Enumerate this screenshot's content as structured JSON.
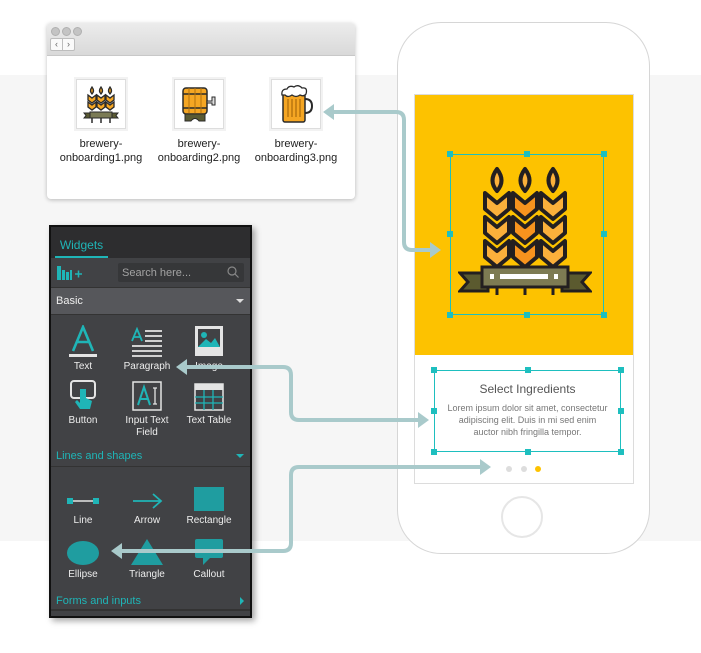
{
  "finder": {
    "nav_back": "‹",
    "nav_forward": "›",
    "files": [
      {
        "name_line1": "brewery-",
        "name_line2": "onboarding1.png",
        "icon": "wheat-icon"
      },
      {
        "name_line1": "brewery-",
        "name_line2": "onboarding2.png",
        "icon": "barrel-icon"
      },
      {
        "name_line1": "brewery-",
        "name_line2": "onboarding3.png",
        "icon": "beer-mug-icon"
      }
    ]
  },
  "widgets_panel": {
    "tab_label": "Widgets",
    "search_placeholder": "Search here...",
    "basic_section": "Basic",
    "basic_widgets": [
      {
        "label": "Text",
        "icon": "text-icon"
      },
      {
        "label": "Paragraph",
        "icon": "paragraph-icon"
      },
      {
        "label": "Image",
        "icon": "image-icon"
      },
      {
        "label": "Button",
        "icon": "button-icon"
      },
      {
        "label_line1": "Input Text",
        "label_line2": "Field",
        "icon": "input-text-icon"
      },
      {
        "label": "Text Table",
        "icon": "table-icon"
      }
    ],
    "lines_section": "Lines and shapes",
    "shape_widgets": [
      {
        "label": "Line",
        "icon": "line-icon"
      },
      {
        "label": "Arrow",
        "icon": "arrow-icon"
      },
      {
        "label": "Rectangle",
        "icon": "rectangle-icon"
      },
      {
        "label": "Ellipse",
        "icon": "ellipse-icon"
      },
      {
        "label": "Triangle",
        "icon": "triangle-icon"
      },
      {
        "label": "Callout",
        "icon": "callout-icon"
      }
    ],
    "forms_section": "Forms and inputs"
  },
  "phone": {
    "title": "Select Ingredients",
    "body_line1": "Lorem ipsum dolor sit amet, consectetur",
    "body_line2": "adipiscing elit. Duis in mi sed enim",
    "body_line3": "auctor nibh fringilla tempor.",
    "pager": {
      "total": 3,
      "active": 3
    }
  },
  "colors": {
    "accent_teal": "#1fb5b7",
    "hero_yellow": "#fdc200",
    "connector": "#a9cacb",
    "panel_bg": "#414245"
  }
}
